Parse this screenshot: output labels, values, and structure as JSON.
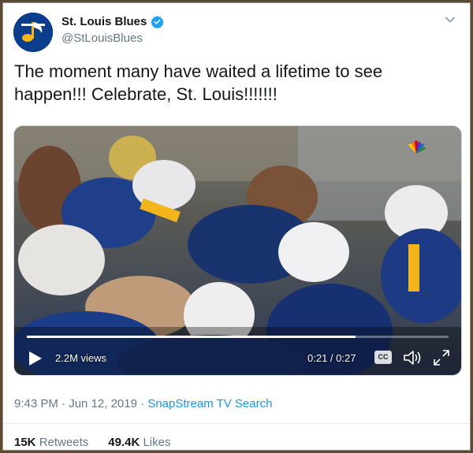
{
  "account": {
    "name": "St. Louis Blues",
    "handle": "@StLouisBlues"
  },
  "tweet": {
    "text": "The moment many have waited a lifetime to see happen!!! Celebrate, St. Louis!!!!!!!"
  },
  "video": {
    "views": "2.2M views",
    "time": "0:21 / 0:27",
    "cc_label": "CC",
    "progress": 0.78
  },
  "meta": {
    "time": "9:43 PM",
    "separator": " · ",
    "date": "Jun 12, 2019",
    "source": "SnapStream TV Search"
  },
  "stats": {
    "retweets_count": "15K",
    "retweets_label": "Retweets",
    "likes_count": "49.4K",
    "likes_label": "Likes"
  },
  "colors": {
    "accent": "#1b95e0",
    "blues_navy": "#0c3d8c",
    "blues_gold": "#f2b51c"
  },
  "icons": [
    "blues-note-logo-icon",
    "verified-badge-icon",
    "chevron-down-icon",
    "play-icon",
    "volume-icon",
    "fullscreen-icon",
    "nbc-peacock-icon"
  ]
}
